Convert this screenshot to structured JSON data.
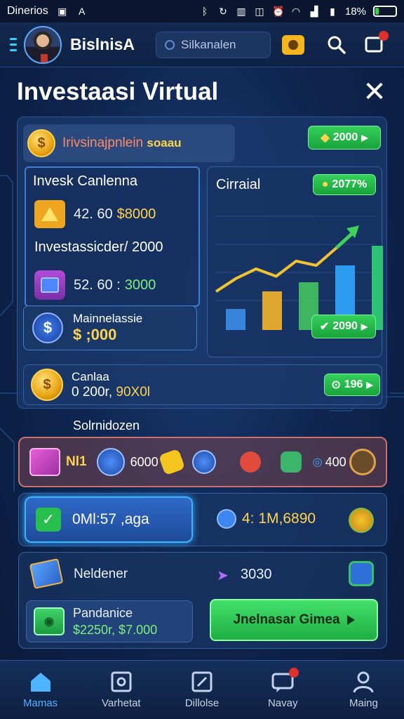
{
  "status_bar": {
    "carrier": "Dinerios",
    "battery": "18%",
    "battery_level": 0.18
  },
  "header": {
    "brand": "BislnisA",
    "search_placeholder": "Silkanalen"
  },
  "page": {
    "title": "Investaasi Virtual"
  },
  "banner": {
    "text": "Irivsinajpnlein",
    "highlight": "soaau",
    "pill": "2000"
  },
  "left_panel": {
    "title": "Invesk Canlenna",
    "row1_prefix": "42. 60",
    "row1_value": "$8000",
    "subtitle": "Investassicder/ 2000",
    "row2_prefix": "52. 60 :",
    "row2_value": "3000"
  },
  "m_panel": {
    "label": "Mainnelassie",
    "value": "$ ;000"
  },
  "chart_panel": {
    "title": "Cirraial",
    "top_pill": "2077%",
    "bottom_pill": "2090"
  },
  "chart_data": {
    "type": "bar",
    "bar_values": [
      30,
      55,
      68,
      92,
      120
    ],
    "line_values": [
      40,
      70,
      92,
      75,
      110,
      100,
      140,
      182
    ],
    "colors": {
      "line": "#f2c230",
      "arrow": "#3fd35a",
      "bars": [
        "#3d8ee8",
        "#f4b42a",
        "#43c35f",
        "#2fa6ff",
        "#2fd37a"
      ]
    }
  },
  "c_panel": {
    "label": "Canlaa",
    "value": "0 200r,",
    "value_hl": "90X0l",
    "pill": "196"
  },
  "section_label": "Solrnidozen",
  "inventory": {
    "item1": "Nl1",
    "item2": "6000",
    "item3": "400"
  },
  "balance": {
    "main": "0Ml:57 ,aga",
    "secondary": "4: 1M,6890"
  },
  "bottom": {
    "note_label": "Neldener",
    "note_value": "3030",
    "pend_label": "Pandanice",
    "pend_value": "$2250r, $7.000",
    "go_button": "Jnelnasar Gimea"
  },
  "nav": [
    {
      "label": "Mamas"
    },
    {
      "label": "Varhetat"
    },
    {
      "label": "Dillolse"
    },
    {
      "label": "Navay"
    },
    {
      "label": "Maing"
    }
  ]
}
